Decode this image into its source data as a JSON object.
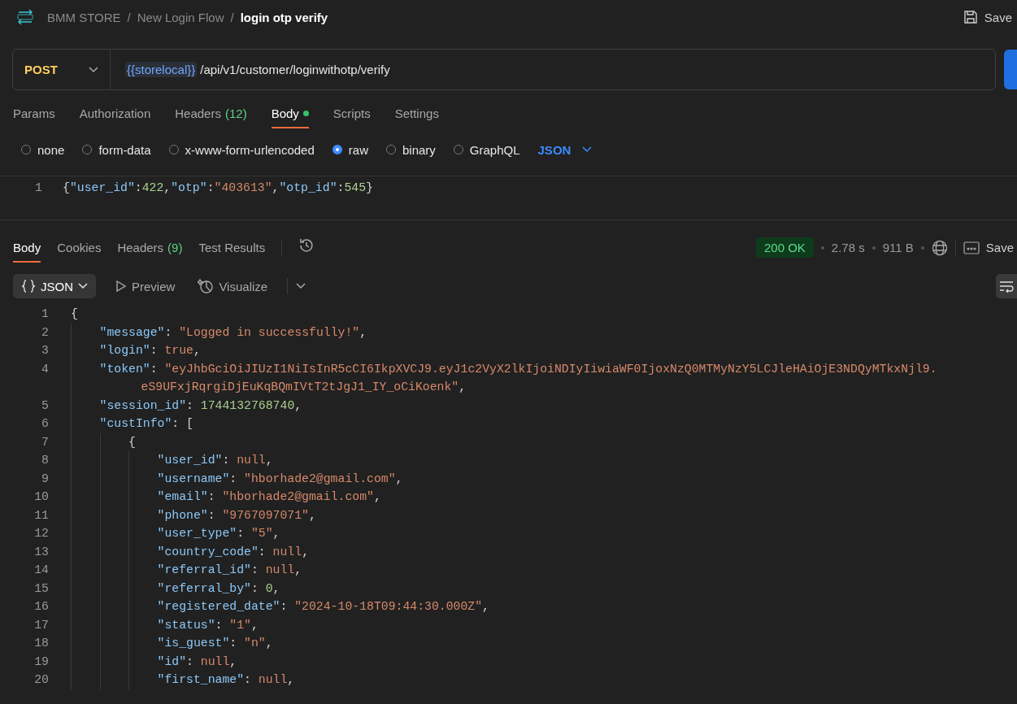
{
  "breadcrumb": [
    {
      "kind": "crumb",
      "text": "BMM STORE"
    },
    {
      "kind": "sep",
      "text": "/"
    },
    {
      "kind": "crumb",
      "text": "New Login Flow"
    },
    {
      "kind": "sep",
      "text": "/"
    },
    {
      "kind": "current",
      "text": "login otp verify"
    }
  ],
  "save_label": "Save",
  "request": {
    "method": "POST",
    "variable": "{{storelocal}}",
    "path": "/api/v1/customer/loginwithotp/verify"
  },
  "request_tabs": [
    {
      "label": "Params",
      "selected": false,
      "dot": false
    },
    {
      "label": "Authorization",
      "selected": false,
      "dot": false
    },
    {
      "label": "Headers",
      "count": "(12)",
      "selected": false,
      "dot": false
    },
    {
      "label": "Body",
      "selected": true,
      "dot": true
    },
    {
      "label": "Scripts",
      "selected": false,
      "dot": false
    },
    {
      "label": "Settings",
      "selected": false,
      "dot": false
    }
  ],
  "body_modes": [
    {
      "label": "none",
      "selected": false
    },
    {
      "label": "form-data",
      "selected": false
    },
    {
      "label": "x-www-form-urlencoded",
      "selected": false
    },
    {
      "label": "raw",
      "selected": true
    },
    {
      "label": "binary",
      "selected": false
    },
    {
      "label": "GraphQL",
      "selected": false
    }
  ],
  "body_format": "JSON",
  "request_body": [
    {
      "num": "1",
      "tokens": [
        {
          "kind": "punct",
          "text": "{"
        },
        {
          "kind": "key",
          "text": "\"user_id\""
        },
        {
          "kind": "punct",
          "text": ":"
        },
        {
          "kind": "number",
          "text": "422"
        },
        {
          "kind": "punct",
          "text": ","
        },
        {
          "kind": "key",
          "text": "\"otp\""
        },
        {
          "kind": "punct",
          "text": ":"
        },
        {
          "kind": "string",
          "text": "\"403613\""
        },
        {
          "kind": "punct",
          "text": ","
        },
        {
          "kind": "key",
          "text": "\"otp_id\""
        },
        {
          "kind": "punct",
          "text": ":"
        },
        {
          "kind": "number",
          "text": "545"
        },
        {
          "kind": "punct",
          "text": "}"
        }
      ]
    }
  ],
  "response_tabs": [
    {
      "label": "Body",
      "selected": true
    },
    {
      "label": "Cookies",
      "selected": false
    },
    {
      "label": "Headers",
      "count": "(9)",
      "selected": false
    },
    {
      "label": "Test Results",
      "selected": false
    }
  ],
  "status": "200 OK",
  "time": "2.78 s",
  "size": "911 B",
  "save_response": "Save",
  "view_modes": [
    {
      "kind": "json",
      "label": "JSON",
      "selected": true
    },
    {
      "kind": "preview",
      "label": "Preview",
      "selected": false
    },
    {
      "kind": "visualize",
      "label": "Visualize",
      "selected": false
    }
  ],
  "response_lines": [
    {
      "num": "1",
      "tokens": [
        {
          "kind": "punct",
          "text": "{"
        }
      ],
      "children": [
        {
          "num": "2",
          "tokens": [
            {
              "kind": "key",
              "text": "\"message\""
            },
            {
              "kind": "punct",
              "text": ": "
            },
            {
              "kind": "string",
              "text": "\"Logged in successfully!\""
            },
            {
              "kind": "punct",
              "text": ","
            }
          ]
        },
        {
          "num": "3",
          "tokens": [
            {
              "kind": "key",
              "text": "\"login\""
            },
            {
              "kind": "punct",
              "text": ": "
            },
            {
              "kind": "literal",
              "text": "true"
            },
            {
              "kind": "punct",
              "text": ","
            }
          ]
        },
        {
          "num": "4",
          "tokens": [
            {
              "kind": "key",
              "text": "\"token\""
            },
            {
              "kind": "punct",
              "text": ": "
            },
            {
              "kind": "string",
              "text": "\"eyJhbGciOiJIUzI1NiIsInR5cCI6IkpXVCJ9.eyJ1c2VyX2lkIjoiNDIyIiwiaWF0IjoxNzQ0MTMyNzY5LCJleHAiOjE3NDQyMTkxNjl9."
            }
          ],
          "continuation": [
            {
              "kind": "string",
              "text": "eS9UFxjRqrgiDjEuKqBQmIVtT2tJgJ1_IY_oCiKoenk\""
            },
            {
              "kind": "punct",
              "text": ","
            }
          ]
        },
        {
          "num": "5",
          "tokens": [
            {
              "kind": "key",
              "text": "\"session_id\""
            },
            {
              "kind": "punct",
              "text": ": "
            },
            {
              "kind": "number",
              "text": "1744132768740"
            },
            {
              "kind": "punct",
              "text": ","
            }
          ]
        },
        {
          "num": "6",
          "tokens": [
            {
              "kind": "key",
              "text": "\"custInfo\""
            },
            {
              "kind": "punct",
              "text": ": ["
            }
          ],
          "children": [
            {
              "num": "7",
              "tokens": [
                {
                  "kind": "punct",
                  "text": "{"
                }
              ],
              "children": [
                {
                  "num": "8",
                  "tokens": [
                    {
                      "kind": "key",
                      "text": "\"user_id\""
                    },
                    {
                      "kind": "punct",
                      "text": ": "
                    },
                    {
                      "kind": "literal",
                      "text": "null"
                    },
                    {
                      "kind": "punct",
                      "text": ","
                    }
                  ]
                },
                {
                  "num": "9",
                  "tokens": [
                    {
                      "kind": "key",
                      "text": "\"username\""
                    },
                    {
                      "kind": "punct",
                      "text": ": "
                    },
                    {
                      "kind": "string",
                      "text": "\"hborhade2@gmail.com\""
                    },
                    {
                      "kind": "punct",
                      "text": ","
                    }
                  ]
                },
                {
                  "num": "10",
                  "tokens": [
                    {
                      "kind": "key",
                      "text": "\"email\""
                    },
                    {
                      "kind": "punct",
                      "text": ": "
                    },
                    {
                      "kind": "string",
                      "text": "\"hborhade2@gmail.com\""
                    },
                    {
                      "kind": "punct",
                      "text": ","
                    }
                  ]
                },
                {
                  "num": "11",
                  "tokens": [
                    {
                      "kind": "key",
                      "text": "\"phone\""
                    },
                    {
                      "kind": "punct",
                      "text": ": "
                    },
                    {
                      "kind": "string",
                      "text": "\"9767097071\""
                    },
                    {
                      "kind": "punct",
                      "text": ","
                    }
                  ]
                },
                {
                  "num": "12",
                  "tokens": [
                    {
                      "kind": "key",
                      "text": "\"user_type\""
                    },
                    {
                      "kind": "punct",
                      "text": ": "
                    },
                    {
                      "kind": "string",
                      "text": "\"5\""
                    },
                    {
                      "kind": "punct",
                      "text": ","
                    }
                  ]
                },
                {
                  "num": "13",
                  "tokens": [
                    {
                      "kind": "key",
                      "text": "\"country_code\""
                    },
                    {
                      "kind": "punct",
                      "text": ": "
                    },
                    {
                      "kind": "literal",
                      "text": "null"
                    },
                    {
                      "kind": "punct",
                      "text": ","
                    }
                  ]
                },
                {
                  "num": "14",
                  "tokens": [
                    {
                      "kind": "key",
                      "text": "\"referral_id\""
                    },
                    {
                      "kind": "punct",
                      "text": ": "
                    },
                    {
                      "kind": "literal",
                      "text": "null"
                    },
                    {
                      "kind": "punct",
                      "text": ","
                    }
                  ]
                },
                {
                  "num": "15",
                  "tokens": [
                    {
                      "kind": "key",
                      "text": "\"referral_by\""
                    },
                    {
                      "kind": "punct",
                      "text": ": "
                    },
                    {
                      "kind": "number",
                      "text": "0"
                    },
                    {
                      "kind": "punct",
                      "text": ","
                    }
                  ]
                },
                {
                  "num": "16",
                  "tokens": [
                    {
                      "kind": "key",
                      "text": "\"registered_date\""
                    },
                    {
                      "kind": "punct",
                      "text": ": "
                    },
                    {
                      "kind": "string",
                      "text": "\"2024-10-18T09:44:30.000Z\""
                    },
                    {
                      "kind": "punct",
                      "text": ","
                    }
                  ]
                },
                {
                  "num": "17",
                  "tokens": [
                    {
                      "kind": "key",
                      "text": "\"status\""
                    },
                    {
                      "kind": "punct",
                      "text": ": "
                    },
                    {
                      "kind": "string",
                      "text": "\"1\""
                    },
                    {
                      "kind": "punct",
                      "text": ","
                    }
                  ]
                },
                {
                  "num": "18",
                  "tokens": [
                    {
                      "kind": "key",
                      "text": "\"is_guest\""
                    },
                    {
                      "kind": "punct",
                      "text": ": "
                    },
                    {
                      "kind": "string",
                      "text": "\"n\""
                    },
                    {
                      "kind": "punct",
                      "text": ","
                    }
                  ]
                },
                {
                  "num": "19",
                  "tokens": [
                    {
                      "kind": "key",
                      "text": "\"id\""
                    },
                    {
                      "kind": "punct",
                      "text": ": "
                    },
                    {
                      "kind": "literal",
                      "text": "null"
                    },
                    {
                      "kind": "punct",
                      "text": ","
                    }
                  ]
                },
                {
                  "num": "20",
                  "tokens": [
                    {
                      "kind": "key",
                      "text": "\"first_name\""
                    },
                    {
                      "kind": "punct",
                      "text": ": "
                    },
                    {
                      "kind": "literal",
                      "text": "null"
                    },
                    {
                      "kind": "punct",
                      "text": ","
                    }
                  ]
                }
              ]
            }
          ]
        }
      ]
    }
  ]
}
